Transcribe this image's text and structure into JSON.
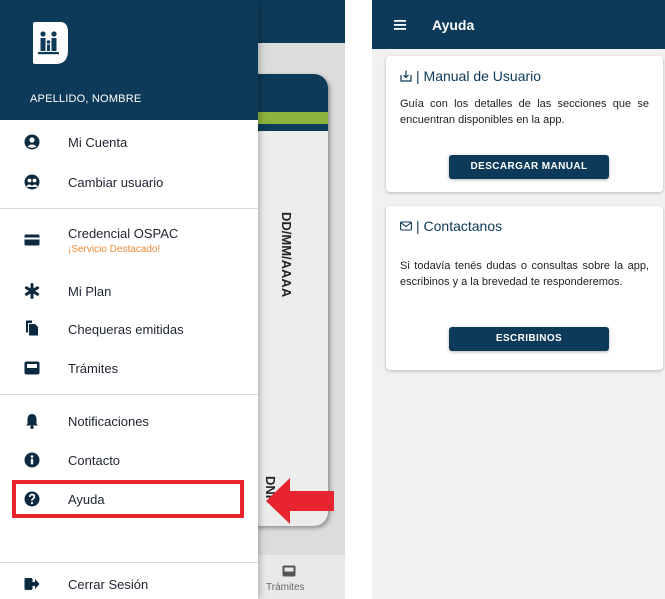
{
  "drawer": {
    "user_name": "APELLIDO, NOMBRE",
    "items": [
      {
        "label": "Mi Cuenta",
        "icon": "account-circle-icon"
      },
      {
        "label": "Cambiar usuario",
        "icon": "switch-user-icon"
      },
      {
        "label": "Credencial OSPAC",
        "sublabel": "¡Servicio Destacado!",
        "icon": "credit-card-icon"
      },
      {
        "label": "Mi Plan",
        "icon": "asterisk-icon"
      },
      {
        "label": "Chequeras emitidas",
        "icon": "copy-documents-icon"
      },
      {
        "label": "Trámites",
        "icon": "inbox-icon"
      },
      {
        "label": "Notificaciones",
        "icon": "bell-icon"
      },
      {
        "label": "Contacto",
        "icon": "info-icon"
      },
      {
        "label": "Ayuda",
        "icon": "help-icon"
      },
      {
        "label": "Cerrar Sesión",
        "icon": "logout-icon"
      }
    ]
  },
  "background_app": {
    "card_date": "DD/MM/AAAA",
    "card_id": "DNI",
    "bottom_nav_label": "Trámites"
  },
  "colors": {
    "primary": "#0c3a58",
    "accent_green": "#8db33c",
    "highlight": "#e8242e",
    "sublabel": "#f28b35"
  },
  "help_screen": {
    "title": "Ayuda",
    "manual_card": {
      "title": "| Manual de Usuario",
      "icon": "download-icon",
      "text": "Guía con los detalles de las secciones que se encuentran disponibles en la app.",
      "button": "DESCARGAR MANUAL"
    },
    "contact_card": {
      "title": "| Contactanos",
      "icon": "mail-icon",
      "text": "Si todavía tenés dudas o consultas sobre la app, escribinos y a la brevedad te responderemos.",
      "button": "ESCRIBINOS"
    }
  }
}
